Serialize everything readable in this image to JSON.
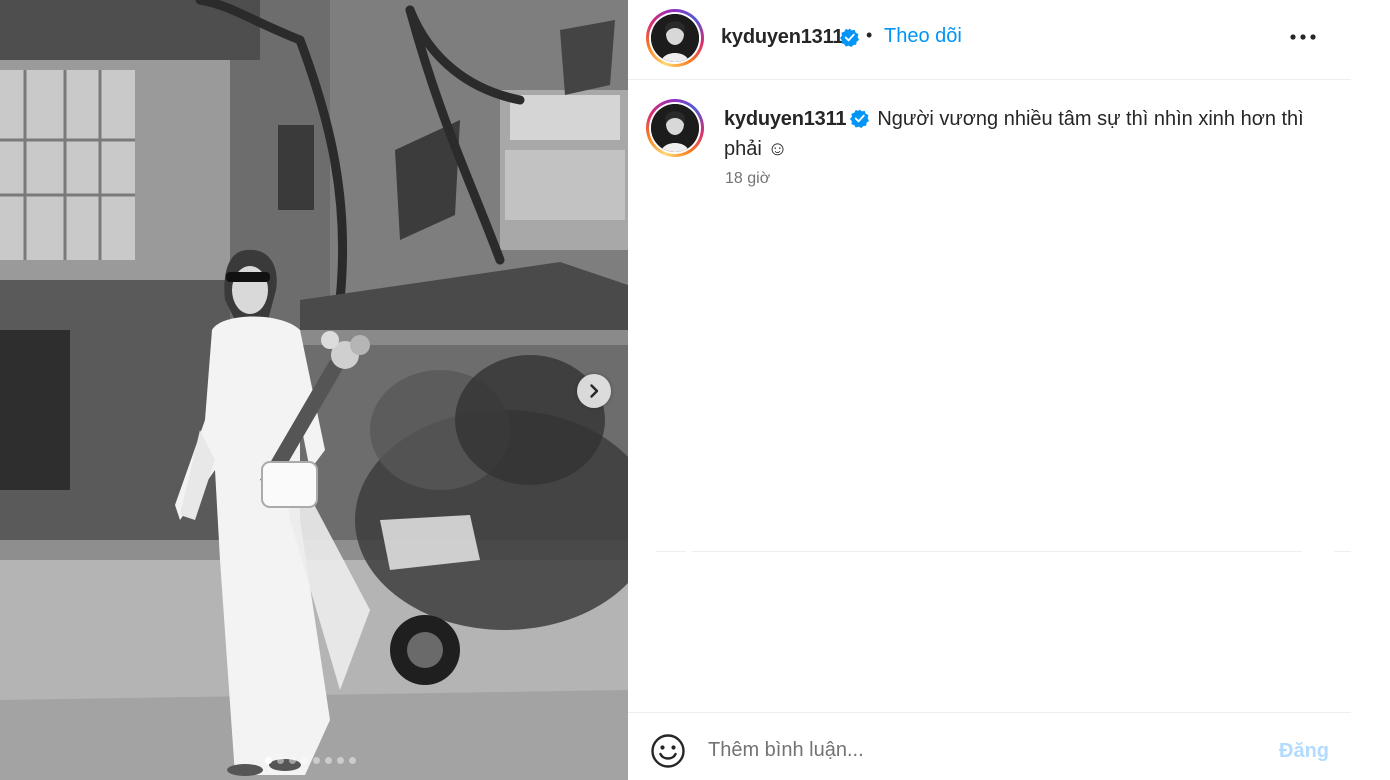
{
  "post": {
    "username": "kyduyen1311",
    "follow_label": "Theo dõi",
    "separator": "•",
    "caption_text": "Người vương nhiều tâm sự thì nhìn xinh hơn thì phải ☺",
    "time_ago": "18 giờ",
    "image_count": 8,
    "active_image_index": 0
  },
  "icons": {
    "verified": "verified-badge-icon",
    "more": "more-options-icon",
    "next": "chevron-right-icon",
    "emoji": "emoji-icon"
  },
  "comment": {
    "placeholder": "Thêm bình luận...",
    "post_label": "Đăng"
  },
  "colors": {
    "link_blue": "#0095f6",
    "verified_blue": "#0095f6",
    "post_disabled": "#b3dbff",
    "secondary_text": "#737373"
  }
}
